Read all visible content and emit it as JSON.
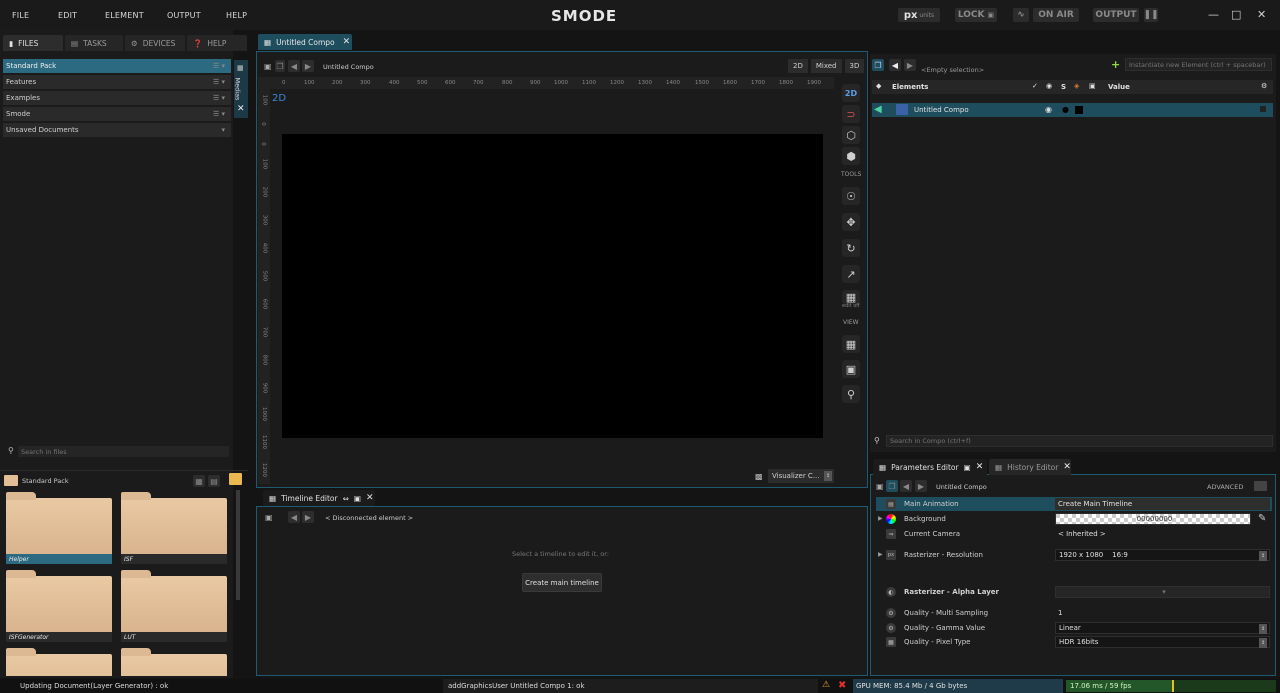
{
  "menu": [
    "FILE",
    "EDIT",
    "ELEMENT",
    "OUTPUT",
    "HELP"
  ],
  "logo": "SMODE",
  "top_right": {
    "units_prefix": "px",
    "units_label": "units",
    "lock": "LOCK",
    "on_air": "ON AIR",
    "output": "OUTPUT"
  },
  "left_tabs": [
    "FILES",
    "TASKS",
    "DEVICES",
    "HELP"
  ],
  "side_label": "Medias",
  "libraries": [
    {
      "label": "Standard Pack",
      "selected": true
    },
    {
      "label": "Features",
      "selected": false
    },
    {
      "label": "Examples",
      "selected": false
    },
    {
      "label": "Smode",
      "selected": false
    },
    {
      "label": "Unsaved Documents",
      "selected": false
    }
  ],
  "search_files_placeholder": "Search in files",
  "pack_title": "Standard Pack",
  "thumbs": [
    {
      "label": "Helper",
      "selected": true
    },
    {
      "label": "ISF",
      "selected": false
    },
    {
      "label": "ISFGenerator",
      "selected": false
    },
    {
      "label": "LUT",
      "selected": false
    },
    {
      "label": "",
      "selected": false
    },
    {
      "label": "",
      "selected": false
    }
  ],
  "compo_tab": "Untitled Compo",
  "viewport": {
    "breadcrumb": "Untitled Compo",
    "modes": [
      "2D",
      "Mixed",
      "3D"
    ],
    "mode_badge": "2D",
    "ruler_h": [
      "0",
      "100",
      "200",
      "300",
      "400",
      "500",
      "600",
      "700",
      "800",
      "900",
      "1000",
      "1100",
      "1200",
      "1300",
      "1400",
      "1500",
      "1600",
      "1700",
      "1800",
      "1900"
    ],
    "ruler_v": [
      "100",
      "0",
      "0",
      "100",
      "200",
      "300",
      "400",
      "500",
      "600",
      "700",
      "800",
      "900",
      "1000",
      "1100",
      "1200"
    ],
    "tools_label": "TOOLS",
    "view_label": "VIEW",
    "edit_off": "edit off",
    "visualizer": "Visualizer C..."
  },
  "timeline": {
    "tab": "Timeline Editor",
    "element": "< Disconnected element >",
    "hint": "Select a timeline to edit it, or:",
    "button": "Create main timeline"
  },
  "elements": {
    "instantiate_placeholder": "Instantiate new Element (ctrl + spacebar)",
    "empty_selection": "<Empty selection>",
    "col_elements": "Elements",
    "col_s": "S",
    "col_value": "Value",
    "row": "Untitled Compo",
    "search_placeholder": "Search in Compo (ctrl+f)"
  },
  "params": {
    "tab": "Parameters Editor",
    "history_tab": "History Editor",
    "breadcrumb": "Untitled Compo",
    "advanced": "ADVANCED",
    "rows": [
      {
        "label": "Main Animation",
        "value": "Create Main Timeline"
      },
      {
        "label": "Background",
        "value": "00000000"
      },
      {
        "label": "Current Camera",
        "value": "< Inherited >"
      },
      {
        "label": "Rasterizer - Resolution",
        "value": "1920 x 1080    16:9"
      },
      {
        "label": "Rasterizer - Alpha Layer",
        "value": ""
      },
      {
        "label": "Quality - Multi Sampling",
        "value": "1"
      },
      {
        "label": "Quality - Gamma Value",
        "value": "Linear"
      },
      {
        "label": "Quality - Pixel Type",
        "value": "HDR 16bits"
      }
    ]
  },
  "status": {
    "left": "Updating Document(Layer Generator) : ok",
    "middle": "addGraphicsUser Untitled Compo 1: ok",
    "gpu": "GPU MEM: 85.4 Mb / 4 Gb bytes",
    "fps": "17.06 ms / 59 fps"
  },
  "colors": {
    "accent": "#2b6a80",
    "highlight_border": "#1e5a70",
    "bg": "#141414"
  }
}
